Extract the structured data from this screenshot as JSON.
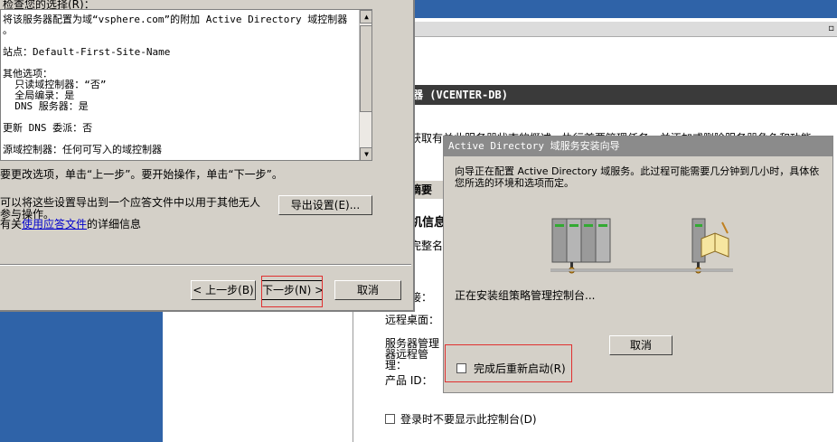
{
  "server_manager": {
    "header": "器 (VCENTER-DB)",
    "desc": "获取有关此服务器状态的概述，执行首要管理任务，并添加或删除服务器角色和功能。",
    "summary_tab": "摘要",
    "info_title": "机信息",
    "full_name_fragment": "完整名",
    "colon_fragment": "：",
    "conn_fragment": "接：",
    "remote_desktop": "远程桌面：",
    "sm_remote_mgmt": "服务器管理器远程管理：",
    "product_id": "产品 ID：",
    "no_show_checkbox": "登录时不要显示此控制台(D)",
    "mini": "▫"
  },
  "config_wizard": {
    "heading": "检查您的选择(R)：",
    "summary_lines": [
      "将该服务器配置为域“vsphere.com”的附加 Active Directory 域控制器",
      "。",
      "",
      "站点：Default-First-Site-Name",
      "",
      "其他选项：",
      "  只读域控制器：“否”",
      "  全局编录：是",
      "  DNS 服务器：是",
      "",
      "更新 DNS 委派：否",
      "",
      "源域控制器：任何可写入的域控制器"
    ],
    "instruction": "要更改选项，单击“上一步”。要开始操作，单击“下一步”。",
    "export_text_1": "可以将这些设置导出到一个应答文件中以用于其他无人",
    "export_text_2": "参与操作。",
    "help_prefix": "有关",
    "help_link": "使用应答文件",
    "help_suffix": "的详细信息",
    "export_button": "导出设置(E)...",
    "back_button": "< 上一步(B)",
    "next_button": "下一步(N) >",
    "cancel_button": "取消"
  },
  "install_dialog": {
    "title": "Active Directory 域服务安装向导",
    "message": "向导正在配置 Active Directory 域服务。此过程可能需要几分钟到几小时，具体依您所选的环境和选项而定。",
    "status": "正在安装组策略管理控制台...",
    "cancel_button": "取消",
    "restart_checkbox": "完成后重新启动(R)",
    "restart_checked": false
  },
  "icons": [
    "server-rack-icon",
    "server-book-icon"
  ]
}
